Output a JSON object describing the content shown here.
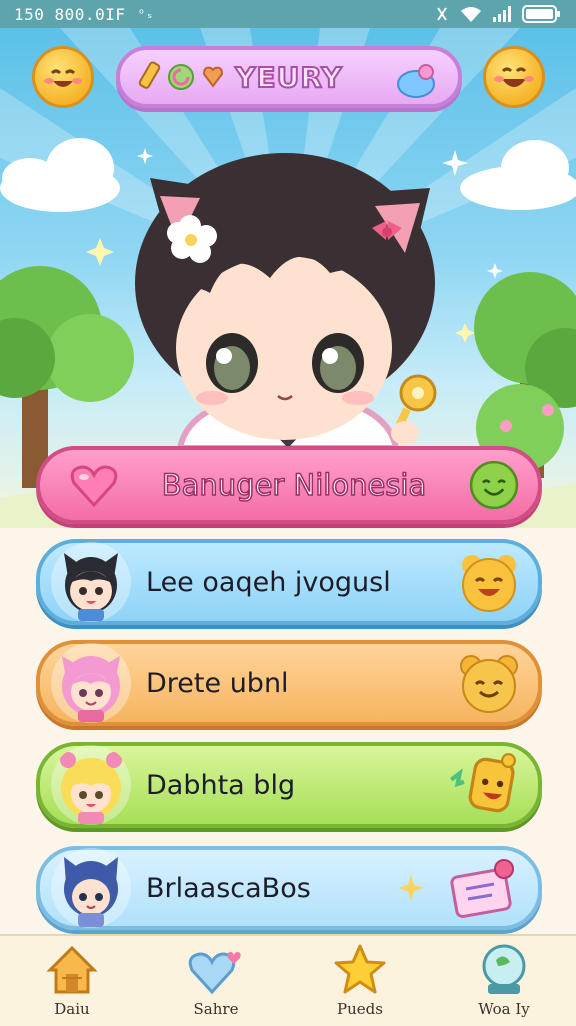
{
  "status_bar": {
    "left_text": "150  800.0IF",
    "extra_glyph": "ᵒₛ"
  },
  "header": {
    "title": "YEURY"
  },
  "menu": {
    "primary": {
      "label": "Banuger Nilonesia",
      "icon": "green-smiley-icon"
    },
    "items": [
      {
        "label": "Lee oaqeh jvogusl",
        "portrait": "black-haired-cat-ear-character",
        "icon": "yellow-bear-smiley-icon",
        "color": "#8fd3f6"
      },
      {
        "label": "Drete ubnl",
        "portrait": "pink-haired-character",
        "icon": "bear-face-icon",
        "color": "#f6b55f"
      },
      {
        "label": "Dabhta blg",
        "portrait": "blonde-haired-character",
        "icon": "happy-block-icon",
        "color": "#a6df58"
      },
      {
        "label": "BrlaascaBos",
        "portrait": "blue-cat-character",
        "icon": "letter-card-icon",
        "color": "#b1e1fa"
      }
    ]
  },
  "bottom_nav": [
    {
      "label": "Daiu",
      "icon": "house-icon"
    },
    {
      "label": "Sahre",
      "icon": "hearts-icon"
    },
    {
      "label": "Pueds",
      "icon": "star-icon"
    },
    {
      "label": "Woa Iy",
      "icon": "globe-icon"
    }
  ],
  "colors": {
    "status_bar": "#5ea4ad",
    "title_pill": "#e7a9f3",
    "primary_button": "#f36ea6",
    "nav_background": "#fbf3dd"
  }
}
